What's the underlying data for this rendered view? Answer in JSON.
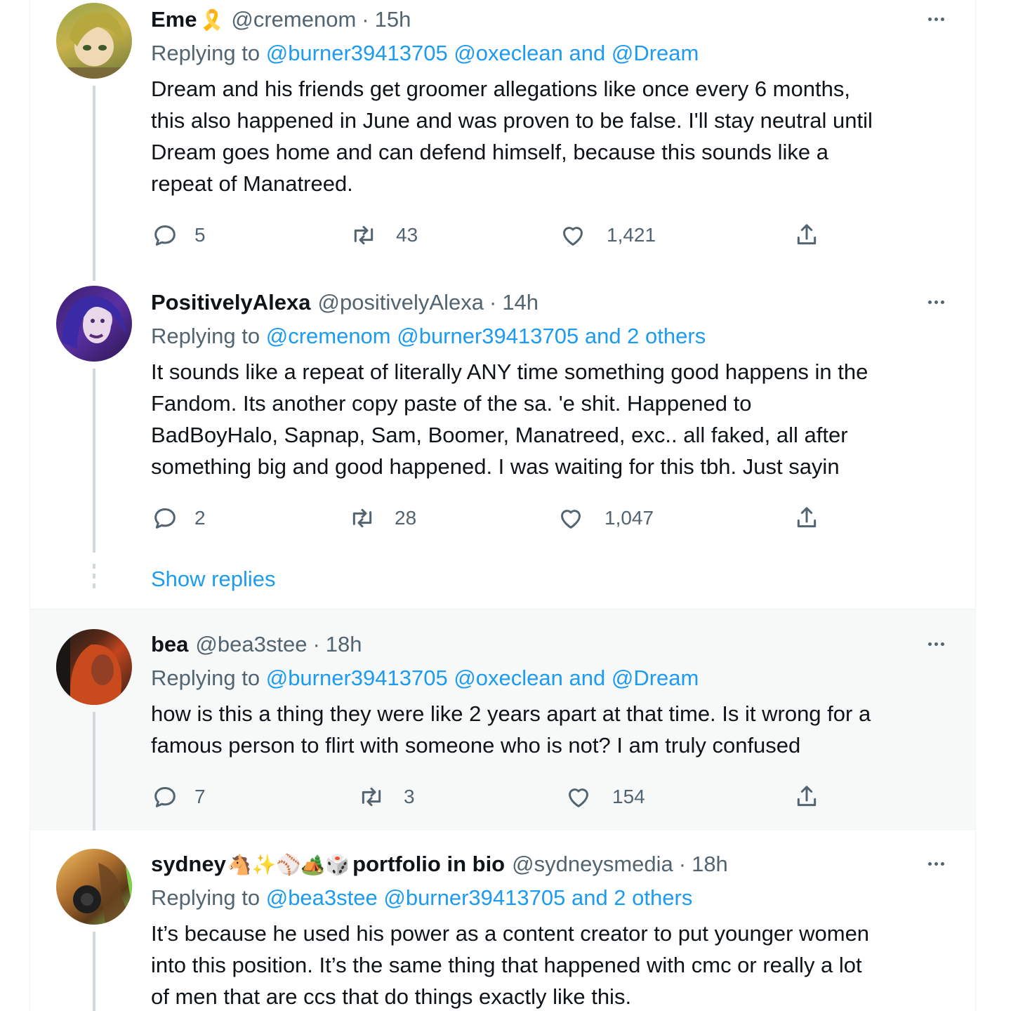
{
  "tweets": [
    {
      "name": "Eme",
      "name_emoji": "🎗️",
      "handle": "@cremenom",
      "separator": "·",
      "time": "15h",
      "replying_prefix": "Replying to ",
      "replying_users": "@burner39413705 @oxeclean and @Dream",
      "body_lines": [
        "Dream and his friends get groomer allegations like once every 6 months,",
        "this also happened in June and was proven to be false. I'll stay neutral until",
        "Dream goes home and can defend himself, because this sounds like a",
        "repeat of Manatreed."
      ],
      "replies": "5",
      "retweets": "43",
      "likes": "1,421"
    },
    {
      "name": "PositivelyAlexa",
      "name_emoji": "",
      "handle": "@positivelyAlexa",
      "separator": "·",
      "time": "14h",
      "replying_prefix": "Replying to ",
      "replying_users": "@cremenom @burner39413705 and 2 others",
      "body_lines": [
        "It sounds like a repeat of literally ANY time something good happens in the",
        "Fandom. Its another copy paste of the sa. 'e shit. Happened to",
        "BadBoyHalo, Sapnap, Sam, Boomer, Manatreed, exc.. all faked, all after",
        "something big and good happened. I was waiting for this tbh. Just sayin"
      ],
      "replies": "2",
      "retweets": "28",
      "likes": "1,047"
    },
    {
      "name": "bea",
      "name_emoji": "",
      "handle": "@bea3stee",
      "separator": "·",
      "time": "18h",
      "replying_prefix": "Replying to ",
      "replying_users": "@burner39413705 @oxeclean and @Dream",
      "body_lines": [
        "how is this a thing they were like 2 years apart at that time. Is it wrong for a",
        "famous person to flirt with someone who is not? I am truly confused"
      ],
      "replies": "7",
      "retweets": "3",
      "likes": "154"
    },
    {
      "name": "sydney",
      "name_emoji": "🐴✨⚾🏕️🎲",
      "name_suffix": "portfolio in bio",
      "handle": "@sydneysmedia",
      "separator": "·",
      "time": "18h",
      "replying_prefix": "Replying to ",
      "replying_users": "@bea3stee @burner39413705 and 2 others",
      "body_lines": [
        "It’s because he used his power as a content creator to put younger women",
        "into this position. It’s the same thing that happened with cmc or really a lot",
        "of men that are ccs that do things exactly like this."
      ]
    }
  ],
  "show_replies_label": "Show replies",
  "icons": {
    "reply": "reply-icon",
    "retweet": "retweet-icon",
    "like": "heart-icon",
    "share": "share-icon",
    "more": "more-icon"
  },
  "colors": {
    "link": "#1d9bf0",
    "secondary_text": "#536471",
    "thread_line": "#cfd9de",
    "highlight_bg": "#f7f9f9"
  }
}
